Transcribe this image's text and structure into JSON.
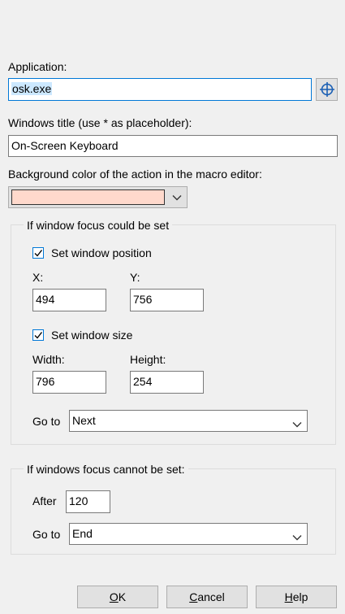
{
  "application": {
    "label": "Application:",
    "value": "osk.exe"
  },
  "window_title": {
    "label": "Windows title (use * as placeholder):",
    "value": "On-Screen Keyboard"
  },
  "background": {
    "label": "Background color of the action in the macro editor:",
    "swatch_color": "#ffd9cc"
  },
  "focus_set": {
    "title": "If window focus could be set",
    "set_position": {
      "label": "Set window position",
      "checked": true
    },
    "x": {
      "label": "X:",
      "value": "494"
    },
    "y": {
      "label": "Y:",
      "value": "756"
    },
    "set_size": {
      "label": "Set window size",
      "checked": true
    },
    "width": {
      "label": "Width:",
      "value": "796"
    },
    "height": {
      "label": "Height:",
      "value": "254"
    },
    "goto": {
      "label": "Go to",
      "value": "Next"
    }
  },
  "focus_not_set": {
    "title": "If windows focus cannot be set:",
    "after": {
      "label": "After",
      "value": "120"
    },
    "goto": {
      "label": "Go to",
      "value": "End"
    }
  },
  "buttons": {
    "ok": {
      "key": "O",
      "rest": "K"
    },
    "cancel": {
      "key": "C",
      "rest": "ancel"
    },
    "help": {
      "key": "H",
      "rest": "elp"
    }
  },
  "colors": {
    "accent": "#0078d7",
    "selection": "#cce8ff"
  }
}
